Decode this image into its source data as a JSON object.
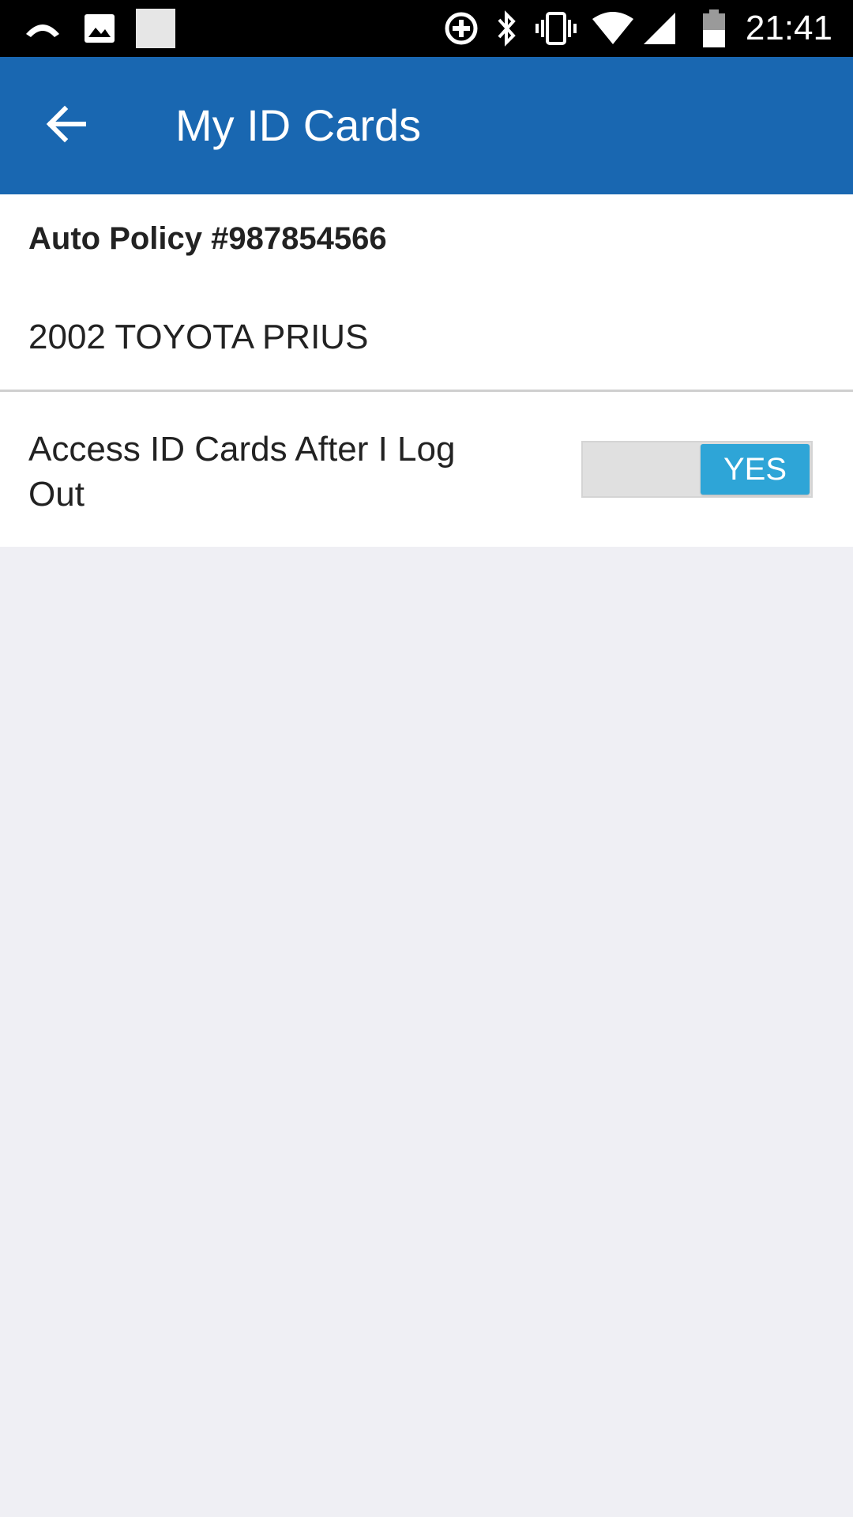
{
  "status_bar": {
    "time": "21:41",
    "icons": [
      "missed-call-icon",
      "image-icon",
      "placeholder-square-icon",
      "data-saver-icon",
      "bluetooth-icon",
      "vibrate-icon",
      "wifi-icon",
      "cell-signal-icon",
      "battery-icon"
    ]
  },
  "app_bar": {
    "title": "My ID Cards",
    "back_icon": "arrow-left-icon",
    "background_color": "#1967b1"
  },
  "policy": {
    "number_label": "Auto Policy #987854566",
    "vehicle": "2002 TOYOTA PRIUS"
  },
  "access_setting": {
    "label": "Access ID Cards After I Log Out",
    "toggle_value": "YES",
    "toggle_color": "#2ea5d7"
  }
}
